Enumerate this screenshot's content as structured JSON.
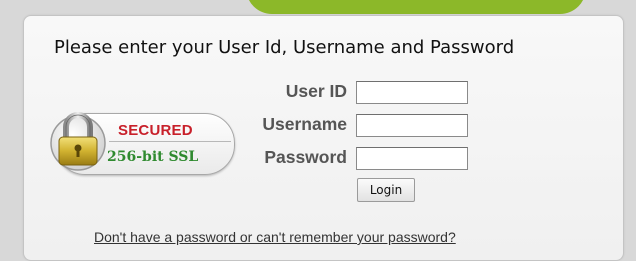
{
  "form": {
    "heading": "Please enter your User Id, Username and Password",
    "fields": [
      {
        "label": "User ID",
        "value": ""
      },
      {
        "label": "Username",
        "value": ""
      },
      {
        "label": "Password",
        "value": ""
      }
    ],
    "login_label": "Login",
    "forgot_link": "Don't have a password or can't remember your password?"
  },
  "badge": {
    "line1": "SECURED",
    "line2": "256-bit SSL",
    "icon": "padlock-icon"
  },
  "colors": {
    "accent_green": "#8cb829",
    "secured_red": "#c8202a",
    "ssl_green": "#2f8a2f",
    "label_gray": "#555555"
  }
}
